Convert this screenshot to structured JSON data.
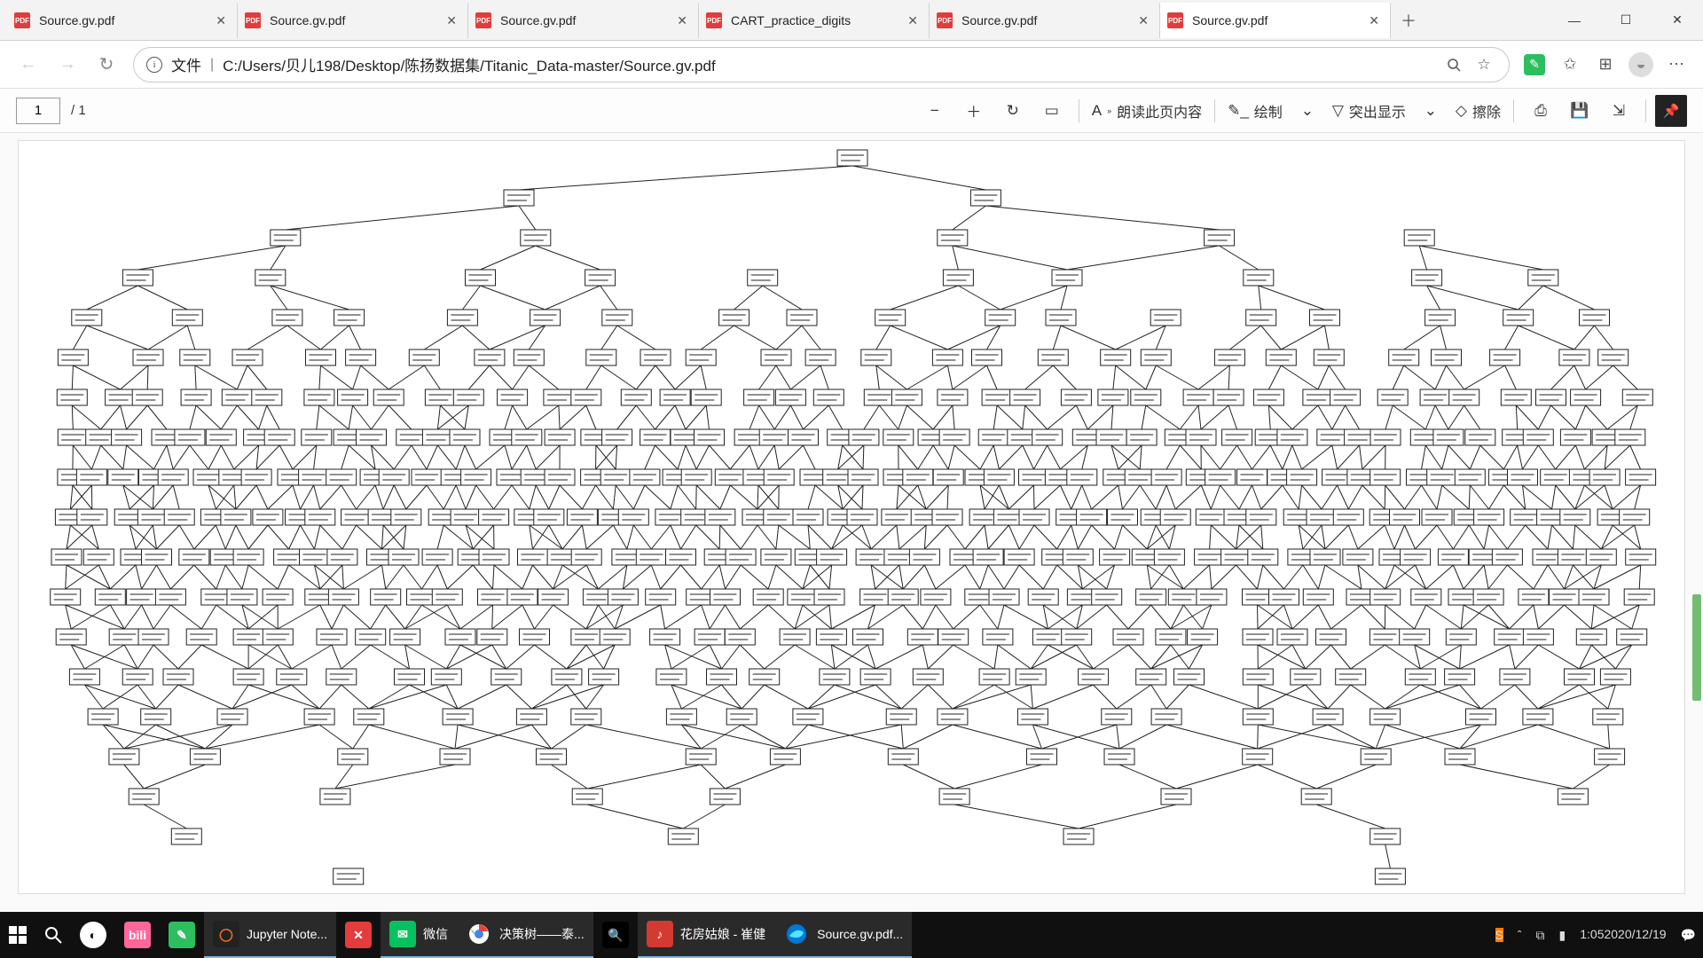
{
  "tabs": [
    {
      "title": "Source.gv.pdf",
      "active": false
    },
    {
      "title": "Source.gv.pdf",
      "active": false
    },
    {
      "title": "Source.gv.pdf",
      "active": false
    },
    {
      "title": "CART_practice_digits",
      "active": false
    },
    {
      "title": "Source.gv.pdf",
      "active": false
    },
    {
      "title": "Source.gv.pdf",
      "active": true
    }
  ],
  "addr": {
    "type_label": "文件",
    "path": "C:/Users/贝儿198/Desktop/陈扬数据集/Titanic_Data-master/Source.gv.pdf"
  },
  "pdf": {
    "page": "1",
    "total": "/ 1",
    "read_aloud": "朗读此页内容",
    "draw": "绘制",
    "highlight": "突出显示",
    "erase": "擦除"
  },
  "taskbar": {
    "items": [
      {
        "kind": "start",
        "label": ""
      },
      {
        "kind": "search",
        "label": ""
      },
      {
        "kind": "taskview",
        "label": ""
      },
      {
        "kind": "app",
        "label": "",
        "icon": "bilibili",
        "color": "#ff6699"
      },
      {
        "kind": "app",
        "label": "",
        "icon": "evernote",
        "color": "#2dbe60"
      },
      {
        "kind": "app",
        "label": "Jupyter Note...",
        "icon": "jupyter",
        "color": "#f37626",
        "active": true
      },
      {
        "kind": "app",
        "label": "",
        "icon": "x",
        "color": "#e23c3c"
      },
      {
        "kind": "app",
        "label": "微信",
        "icon": "wechat",
        "color": "#07c160",
        "active": true
      },
      {
        "kind": "app",
        "label": "决策树——泰...",
        "icon": "chrome",
        "active": true
      },
      {
        "kind": "app",
        "label": "",
        "icon": "search",
        "color": "#ff8800"
      },
      {
        "kind": "app",
        "label": "花房姑娘 - 崔健",
        "icon": "netease",
        "color": "#d33a31",
        "active": true
      },
      {
        "kind": "app",
        "label": "Source.gv.pdf...",
        "icon": "edge",
        "color": "#0078d7",
        "active": true
      }
    ],
    "tray": {
      "sogou": "S",
      "time": "1:05",
      "date": "2020/12/19"
    }
  }
}
